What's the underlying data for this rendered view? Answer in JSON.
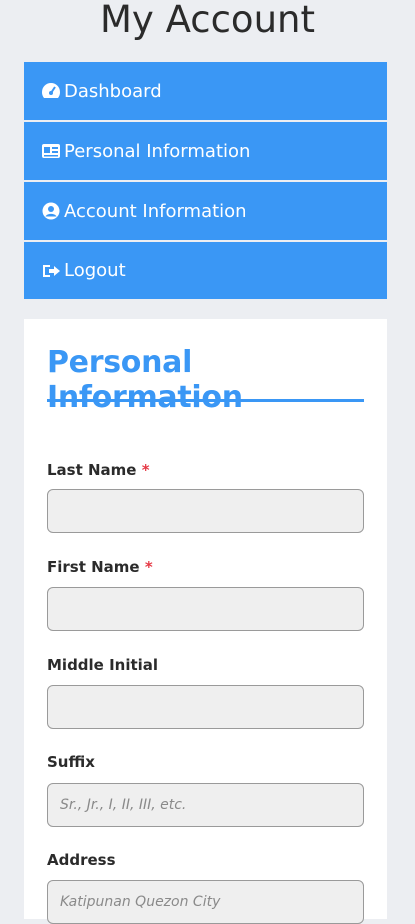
{
  "header": {
    "title": "My Account"
  },
  "nav": {
    "items": [
      {
        "label": "Dashboard",
        "icon": "dashboard-icon"
      },
      {
        "label": "Personal Information",
        "icon": "id-card-icon"
      },
      {
        "label": "Account Information",
        "icon": "user-circle-icon"
      },
      {
        "label": "Logout",
        "icon": "logout-icon"
      }
    ]
  },
  "form": {
    "title": "Personal Information",
    "required_mark": "*",
    "last_name": {
      "label": "Last Name",
      "value": "",
      "placeholder": ""
    },
    "first_name": {
      "label": "First Name",
      "value": "",
      "placeholder": ""
    },
    "middle_initial": {
      "label": "Middle Initial",
      "value": "",
      "placeholder": ""
    },
    "suffix": {
      "label": "Suffix",
      "value": "",
      "placeholder": "Sr., Jr., I, II, III, etc."
    },
    "address": {
      "label": "Address",
      "value": "",
      "placeholder": "Katipunan Quezon City"
    }
  },
  "colors": {
    "accent": "#3a97f5",
    "background": "#eceef2",
    "required": "#e53945",
    "input_bg": "#efefef"
  }
}
